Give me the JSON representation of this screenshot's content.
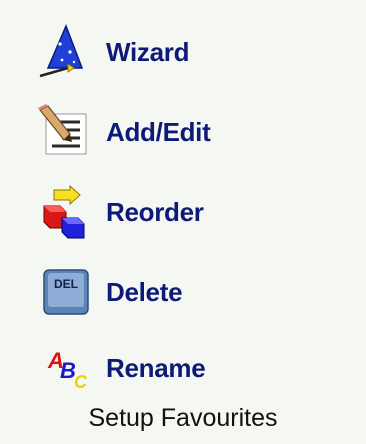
{
  "menu": {
    "items": [
      {
        "label": "Wizard",
        "icon": "wizard-hat-icon"
      },
      {
        "label": "Add/Edit",
        "icon": "edit-pencil-icon"
      },
      {
        "label": "Reorder",
        "icon": "reorder-blocks-icon"
      },
      {
        "label": "Delete",
        "icon": "delete-key-icon",
        "icon_text": "DEL"
      },
      {
        "label": "Rename",
        "icon": "rename-abc-icon",
        "icon_text": [
          "A",
          "B",
          "C"
        ]
      }
    ]
  },
  "footer": {
    "title": "Setup Favourites"
  },
  "colors": {
    "background": "#f4f7f2",
    "label": "#0e1a78"
  }
}
